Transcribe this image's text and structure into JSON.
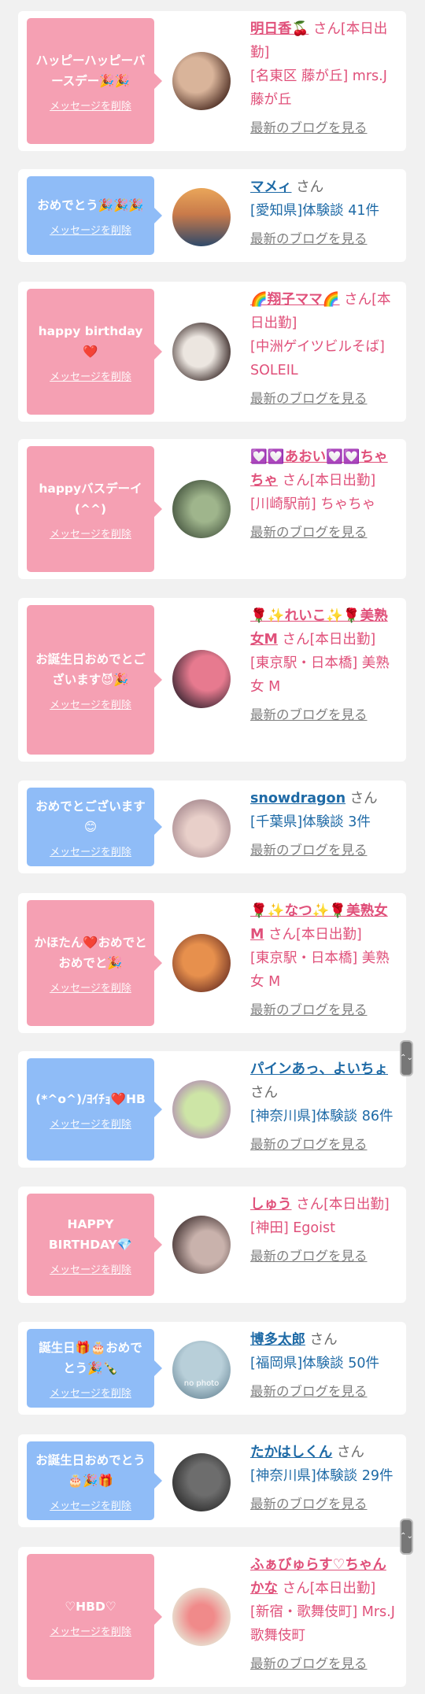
{
  "blog_link": "最新のブログを見る",
  "delete_label": "メッセージを削除",
  "san": "さん",
  "entries": [
    {
      "color": "pink",
      "message": "ハッピーハッピーバースデー🎉🎉",
      "name": "明日香🍒",
      "suffix": "さん[本日出勤]",
      "meta": "[名東区 藤が丘] mrs.J藤が丘",
      "kind": "girl",
      "av1": "#d9b49a",
      "av2": "#5a3a2e"
    },
    {
      "color": "blue",
      "message": "おめでとう🎉🎉🎉",
      "name": "マメィ",
      "suffix": "さん",
      "meta": "[愛知県]体験談 41件",
      "kind": "man",
      "av1": "#e9a65a",
      "av2": "#2f4a6a"
    },
    {
      "color": "pink",
      "message": "happy birthday❤️",
      "name": "🌈翔子ママ🌈",
      "suffix": "さん[本日出勤]",
      "meta": "[中洲ゲイツビルそば] SOLEIL",
      "kind": "girl",
      "av1": "#ece6e0",
      "av2": "#3a2a28"
    },
    {
      "color": "pink",
      "message": "happyバスデーイ(^^)",
      "name": "💟💟あおい💟💟ちゃちゃ",
      "suffix": "さん[本日出勤]",
      "meta": "[川崎駅前] ちゃちゃ",
      "kind": "girl",
      "av1": "#9fb58c",
      "av2": "#3f4e3a"
    },
    {
      "color": "pink",
      "message": "お誕生日おめでとございます😈🎉",
      "name": "🌹✨れいこ✨🌹美熟女M",
      "suffix": "さん[本日出勤]",
      "meta": "[東京駅・日本橋] 美熟女 M",
      "kind": "girl",
      "av1": "#e77a8f",
      "av2": "#2b1f2a"
    },
    {
      "color": "blue",
      "message": "おめでとございます😊",
      "name": "snowdragon",
      "suffix": "さん",
      "meta": "[千葉県]体験談 3件",
      "kind": "man",
      "av1": "#e8cfc9",
      "av2": "#9a7c84"
    },
    {
      "color": "pink",
      "message": "かほたん❤️おめでとおめでと🎉",
      "name": "🌹✨なつ✨🌹美熟女M",
      "suffix": "さん[本日出勤]",
      "meta": "[東京駅・日本橋] 美熟女 M",
      "kind": "girl",
      "av1": "#e7904d",
      "av2": "#6a2e22"
    },
    {
      "color": "blue",
      "message": "(*^o^)/ﾖｲﾁｮ❤️HB",
      "name": "パインあっ、よいちょ",
      "suffix": "さん",
      "meta": "[神奈川県]体験談 86件",
      "kind": "man",
      "av1": "#cde5a6",
      "av2": "#a76db7"
    },
    {
      "color": "pink",
      "message": "HAPPY BIRTHDAY💎",
      "name": "しゅう",
      "suffix": "さん[本日出勤]",
      "meta": "[神田] Egoist",
      "kind": "girl",
      "av1": "#c9b2ac",
      "av2": "#3a2a2a"
    },
    {
      "color": "blue",
      "message": "誕生日🎁🎂おめでとう🎉🍾",
      "name": "博多太郎",
      "suffix": "さん",
      "meta": "[福岡県]体験談 50件",
      "kind": "man",
      "av1": "#b8cfd9",
      "av2": "#5c7b8c",
      "nophoto": "no photo"
    },
    {
      "color": "blue",
      "message": "お誕生日おめでとう🎂🎉🎁",
      "name": "たかはしくん",
      "suffix": "さん",
      "meta": "[神奈川県]体験談 29件",
      "kind": "man",
      "av1": "#6d6d6d",
      "av2": "#1f1f1f"
    },
    {
      "color": "pink",
      "message": "♡HBD♡",
      "name": "ふぁびゅらす♡ちゃんかな",
      "suffix": "さん[本日出勤]",
      "meta": "[新宿・歌舞伎町] Mrs.J 歌舞伎町",
      "kind": "girl",
      "av1": "#f08a8a",
      "av2": "#e9d7c9"
    }
  ],
  "scroll_icon": "⌃⌄"
}
